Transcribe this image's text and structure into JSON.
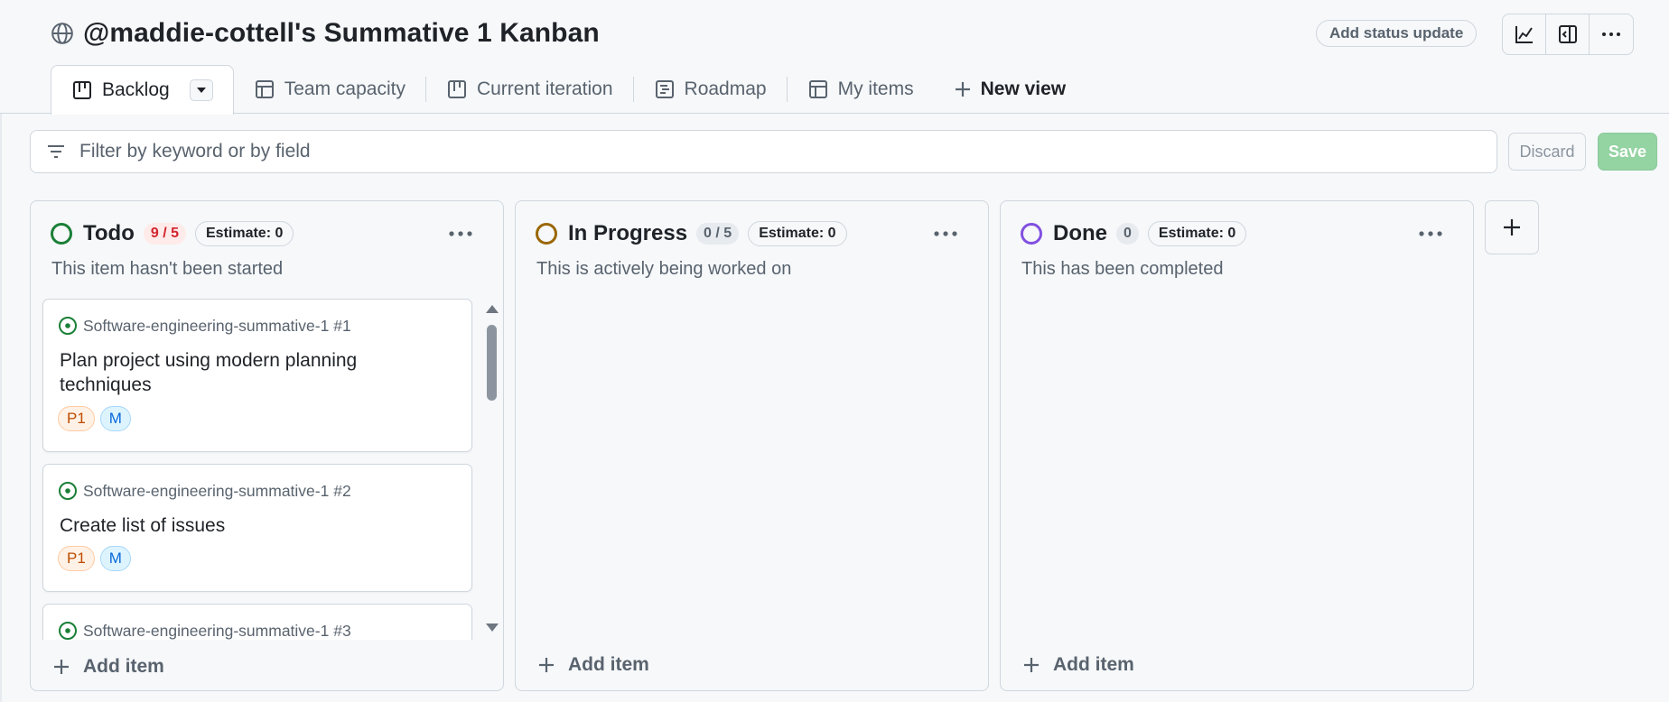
{
  "project": {
    "title": "@maddie-cottell's Summative 1 Kanban",
    "status_update_label": "Add status update"
  },
  "toolbar": {
    "icons": [
      "insights-icon",
      "side-panel-icon",
      "more-options-icon"
    ]
  },
  "tabs": [
    {
      "label": "Backlog",
      "icon": "board-icon",
      "active": true
    },
    {
      "label": "Team capacity",
      "icon": "table-icon"
    },
    {
      "label": "Current iteration",
      "icon": "board-icon"
    },
    {
      "label": "Roadmap",
      "icon": "roadmap-icon"
    },
    {
      "label": "My items",
      "icon": "table-icon"
    },
    {
      "label": "New view",
      "icon": "plus-icon"
    }
  ],
  "filter": {
    "placeholder": "Filter by keyword or by field",
    "discard_label": "Discard",
    "save_label": "Save"
  },
  "columns": [
    {
      "name": "Todo",
      "count": "9 / 5",
      "estimate": "Estimate: 0",
      "description": "This item hasn't been started",
      "add_label": "Add item",
      "color": "#1a7f37",
      "cards": [
        {
          "repo": "Software-engineering-summative-1 #1",
          "title": "Plan project using modern planning techniques",
          "labels": [
            "P1",
            "M"
          ]
        },
        {
          "repo": "Software-engineering-summative-1 #2",
          "title": "Create list of issues",
          "labels": [
            "P1",
            "M"
          ]
        },
        {
          "repo": "Software-engineering-summative-1 #3",
          "title": "",
          "labels": []
        }
      ]
    },
    {
      "name": "In Progress",
      "count": "0 / 5",
      "estimate": "Estimate: 0",
      "description": "This is actively being worked on",
      "add_label": "Add item",
      "color": "#9a6700",
      "cards": []
    },
    {
      "name": "Done",
      "count": "0",
      "estimate": "Estimate: 0",
      "description": "This has been completed",
      "add_label": "Add item",
      "color": "#8250df",
      "cards": []
    }
  ]
}
